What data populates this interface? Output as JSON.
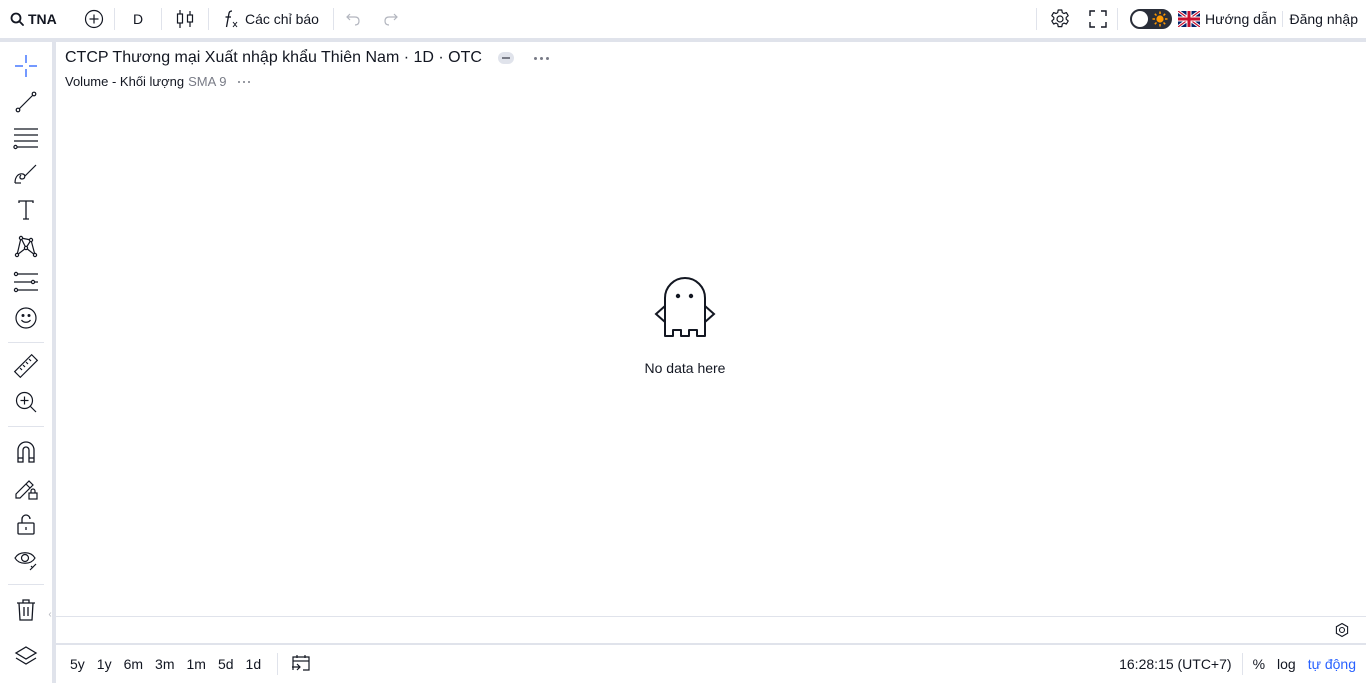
{
  "topbar": {
    "symbol": "TNA",
    "interval": "D",
    "indicators_label": "Các chỉ báo",
    "guide_label": "Hướng dẫn",
    "login_label": "Đăng nhập"
  },
  "icons": {
    "search": "search-icon",
    "add": "plus-circle-icon",
    "chart_type": "candlestick-icon",
    "indicators": "fx-icon",
    "undo": "undo-icon",
    "redo": "redo-icon",
    "settings": "gear-icon",
    "fullscreen": "fullscreen-icon",
    "theme": "theme-toggle-icon",
    "language": "uk-flag-icon"
  },
  "lefttoolbar": {
    "tools": [
      "crosshair-icon",
      "trend-line-icon",
      "fib-lines-icon",
      "brush-icon",
      "text-icon",
      "pattern-icon",
      "forecast-icon",
      "emoji-icon",
      "ruler-icon",
      "zoom-in-icon",
      "magnet-icon",
      "lock-drawing-icon",
      "lock-icon",
      "eye-icon",
      "trash-icon",
      "layers-icon"
    ]
  },
  "chart": {
    "legend_title": "CTCP Thương mại Xuất nhập khẩu Thiên Nam · 1D · OTC",
    "volume_label": "Volume - Khối lượng",
    "volume_sma": "SMA 9",
    "no_data": "No data here"
  },
  "bottombar": {
    "ranges": [
      "5y",
      "1y",
      "6m",
      "3m",
      "1m",
      "5d",
      "1d"
    ],
    "clock": "16:28:15 (UTC+7)",
    "percent": "%",
    "log": "log",
    "auto": "tự động"
  },
  "colors": {
    "accent": "#2962ff",
    "text": "#131722",
    "muted": "#787b86",
    "border": "#e0e3eb",
    "sun": "#ff9800"
  }
}
